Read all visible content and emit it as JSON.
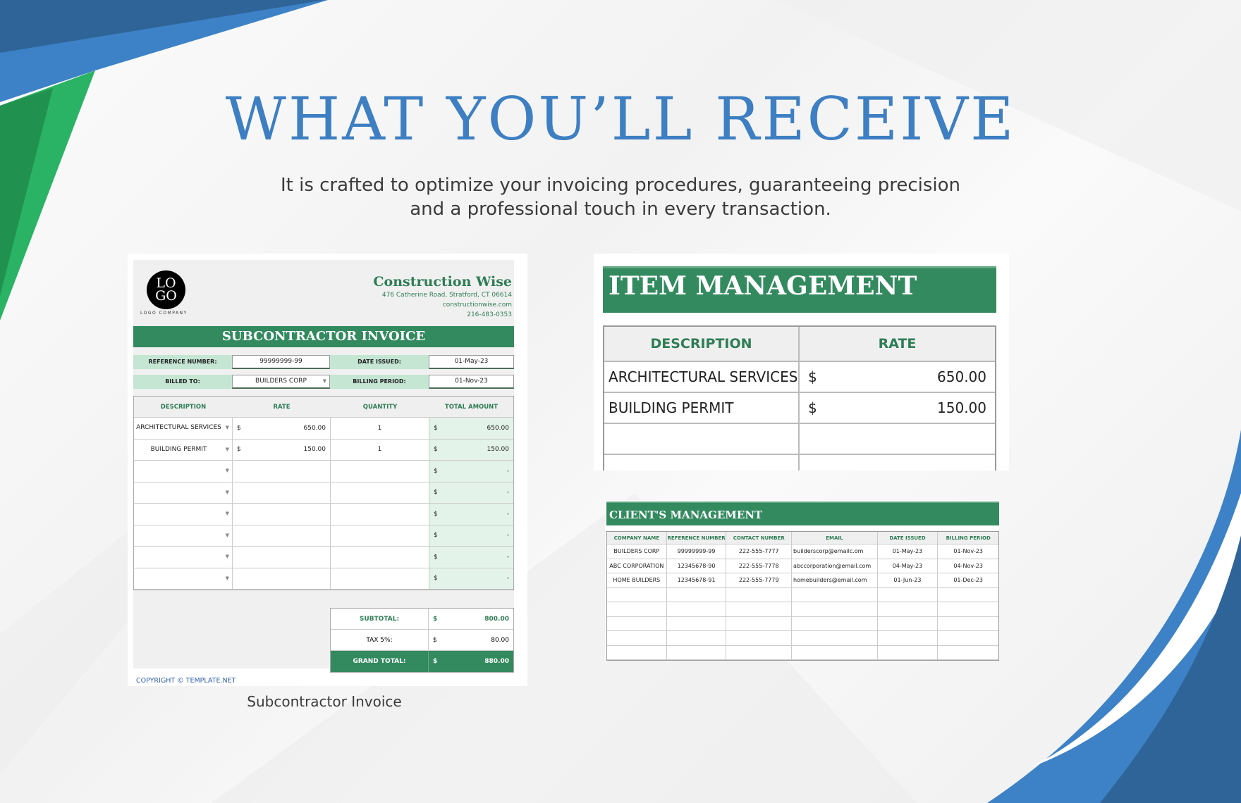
{
  "header": {
    "title": "WHAT YOU’LL RECEIVE",
    "subtitle_line1": "It is crafted to optimize your invoicing procedures, guaranteeing precision",
    "subtitle_line2": "and a professional touch in every transaction."
  },
  "colors": {
    "title_blue": "#3d7fc2",
    "brand_green": "#338a5f",
    "light_green": "#c4e6d3",
    "deco_blue": "#3d82c6",
    "deco_dark_blue": "#2f6498",
    "deco_green": "#2bb365"
  },
  "invoice": {
    "caption": "Subcontractor Invoice",
    "logo_line1": "LO",
    "logo_line2": "GO",
    "logo_company": "LOGO COMPANY",
    "company_name": "Construction Wise",
    "address": "476 Catherine Road, Stratford, CT 06614",
    "website": "constructionwise.com",
    "phone": "216-483-0353",
    "banner": "SUBCONTRACTOR INVOICE",
    "reference_label": "REFERENCE NUMBER:",
    "reference_value": "99999999-99",
    "date_issued_label": "DATE ISSUED:",
    "date_issued_value": "01-May-23",
    "billed_to_label": "BILLED TO:",
    "billed_to_value": "BUILDERS CORP",
    "billing_period_label": "BILLING PERIOD:",
    "billing_period_value": "01-Nov-23",
    "columns": [
      "DESCRIPTION",
      "RATE",
      "QUANTITY",
      "TOTAL AMOUNT"
    ],
    "currency": "$",
    "rows": [
      {
        "description": "ARCHITECTURAL SERVICES",
        "rate": "650.00",
        "quantity": "1",
        "total": "650.00"
      },
      {
        "description": "BUILDING PERMIT",
        "rate": "150.00",
        "quantity": "1",
        "total": "150.00"
      },
      {
        "description": "",
        "rate": "",
        "quantity": "",
        "total": "-"
      },
      {
        "description": "",
        "rate": "",
        "quantity": "",
        "total": "-"
      },
      {
        "description": "",
        "rate": "",
        "quantity": "",
        "total": "-"
      },
      {
        "description": "",
        "rate": "",
        "quantity": "",
        "total": "-"
      },
      {
        "description": "",
        "rate": "",
        "quantity": "",
        "total": "-"
      },
      {
        "description": "",
        "rate": "",
        "quantity": "",
        "total": "-"
      }
    ],
    "subtotal_label": "SUBTOTAL:",
    "subtotal_value": "800.00",
    "tax_label": "TAX 5%:",
    "tax_value": "80.00",
    "grand_total_label": "GRAND TOTAL:",
    "grand_total_value": "880.00",
    "copyright": "COPYRIGHT © TEMPLATE.NET"
  },
  "item_management": {
    "banner": "ITEM MANAGEMENT",
    "columns": [
      "DESCRIPTION",
      "RATE"
    ],
    "currency": "$",
    "rows": [
      {
        "description": "ARCHITECTURAL SERVICES",
        "rate": "650.00"
      },
      {
        "description": "BUILDING PERMIT",
        "rate": "150.00"
      },
      {
        "description": "",
        "rate": ""
      },
      {
        "description": "",
        "rate": ""
      }
    ]
  },
  "clients": {
    "banner": "CLIENT'S MANAGEMENT",
    "columns": [
      "COMPANY NAME",
      "REFERENCE NUMBER",
      "CONTACT NUMBER",
      "EMAIL",
      "DATE ISSUED",
      "BILLING PERIOD"
    ],
    "rows": [
      [
        "BUILDERS CORP",
        "99999999-99",
        "222-555-7777",
        "builderscorp@emailc.om",
        "01-May-23",
        "01-Nov-23"
      ],
      [
        "ABC CORPORATION",
        "12345678-90",
        "222-555-7778",
        "abccorporation@email.com",
        "04-May-23",
        "04-Nov-23"
      ],
      [
        "HOME BUILDERS",
        "12345678-91",
        "222-555-7779",
        "homebuilders@email.com",
        "01-Jun-23",
        "01-Dec-23"
      ],
      [
        "",
        "",
        "",
        "",
        "",
        ""
      ],
      [
        "",
        "",
        "",
        "",
        "",
        ""
      ],
      [
        "",
        "",
        "",
        "",
        "",
        ""
      ],
      [
        "",
        "",
        "",
        "",
        "",
        ""
      ],
      [
        "",
        "",
        "",
        "",
        "",
        ""
      ]
    ]
  }
}
